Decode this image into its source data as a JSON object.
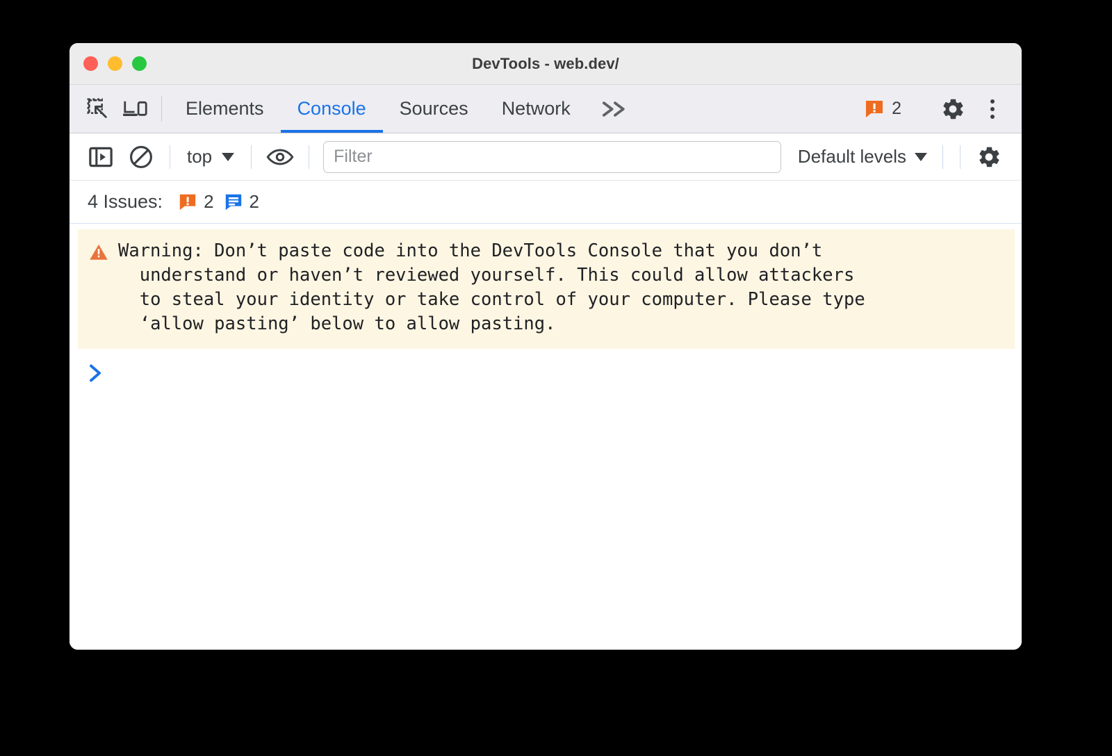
{
  "window": {
    "title": "DevTools - web.dev/",
    "traffic_lights": [
      {
        "name": "close",
        "color": "#ff5f57"
      },
      {
        "name": "minimize",
        "color": "#febc2e"
      },
      {
        "name": "maximize",
        "color": "#28c840"
      }
    ]
  },
  "tabbar": {
    "inspect_icon": "inspect-element-icon",
    "device_icon": "device-toolbar-icon",
    "tabs": [
      {
        "label": "Elements",
        "active": false
      },
      {
        "label": "Console",
        "active": true
      },
      {
        "label": "Sources",
        "active": false
      },
      {
        "label": "Network",
        "active": false
      }
    ],
    "more_tabs": "»",
    "warning_badge_count": "2",
    "settings_icon": "gear-icon",
    "menu_icon": "kebab-menu-icon"
  },
  "console_toolbar": {
    "sidebar_toggle_icon": "console-sidebar-toggle-icon",
    "clear_icon": "clear-console-icon",
    "context": "top",
    "eye_icon": "live-expression-eye-icon",
    "filter_placeholder": "Filter",
    "filter_value": "",
    "levels_label": "Default levels",
    "settings_icon": "gear-icon"
  },
  "issues_bar": {
    "label": "4 Issues:",
    "items": [
      {
        "icon": "warning-badge-icon",
        "count": "2",
        "color": "#ee6c21"
      },
      {
        "icon": "info-badge-icon",
        "count": "2",
        "color": "#1a73e8"
      }
    ]
  },
  "console": {
    "warning_icon": "warning-triangle-icon",
    "warning_message": "Warning: Don’t paste code into the DevTools Console that you don’t\n  understand or haven’t reviewed yourself. This could allow attackers\n  to steal your identity or take control of your computer. Please type\n  ‘allow pasting’ below to allow pasting.",
    "prompt_symbol": "›",
    "input_value": ""
  },
  "colors": {
    "accent_blue": "#1a73e8",
    "warning_orange": "#ee6c21",
    "warning_banner_bg": "#fdf6e3",
    "tabbar_bg": "#ededf2",
    "titlebar_bg": "#ececed"
  }
}
